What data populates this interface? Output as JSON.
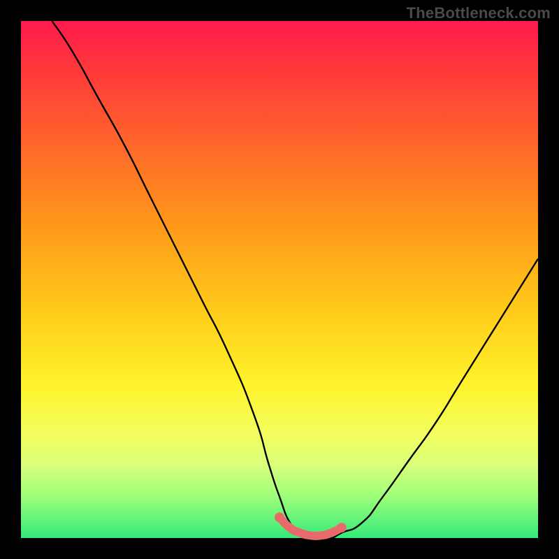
{
  "watermark": "TheBottleneck.com",
  "colors": {
    "frame_bg": "#000000",
    "curve": "#000000",
    "highlight": "#e86a6a",
    "gradient_top": "#ff1a4d",
    "gradient_bottom": "#35e97a"
  },
  "chart_data": {
    "type": "line",
    "title": "",
    "xlabel": "",
    "ylabel": "",
    "xlim": [
      0,
      100
    ],
    "ylim": [
      0,
      100
    ],
    "grid": false,
    "legend": false,
    "series": [
      {
        "name": "bottleneck-curve",
        "x": [
          6,
          10,
          15,
          20,
          25,
          30,
          35,
          40,
          45,
          48,
          50,
          52,
          54,
          56,
          58,
          60,
          62,
          66,
          70,
          75,
          80,
          85,
          90,
          95,
          100
        ],
        "y": [
          100,
          94,
          85,
          76,
          66,
          56,
          46,
          36,
          24,
          14,
          8,
          3,
          1,
          0,
          0,
          0,
          1,
          3,
          8,
          15,
          22,
          30,
          38,
          46,
          54
        ]
      },
      {
        "name": "minimum-region",
        "x": [
          50,
          52,
          54,
          56,
          58,
          60,
          62
        ],
        "y": [
          4,
          2,
          1,
          0.5,
          0.5,
          1,
          2
        ]
      }
    ],
    "annotations": []
  }
}
